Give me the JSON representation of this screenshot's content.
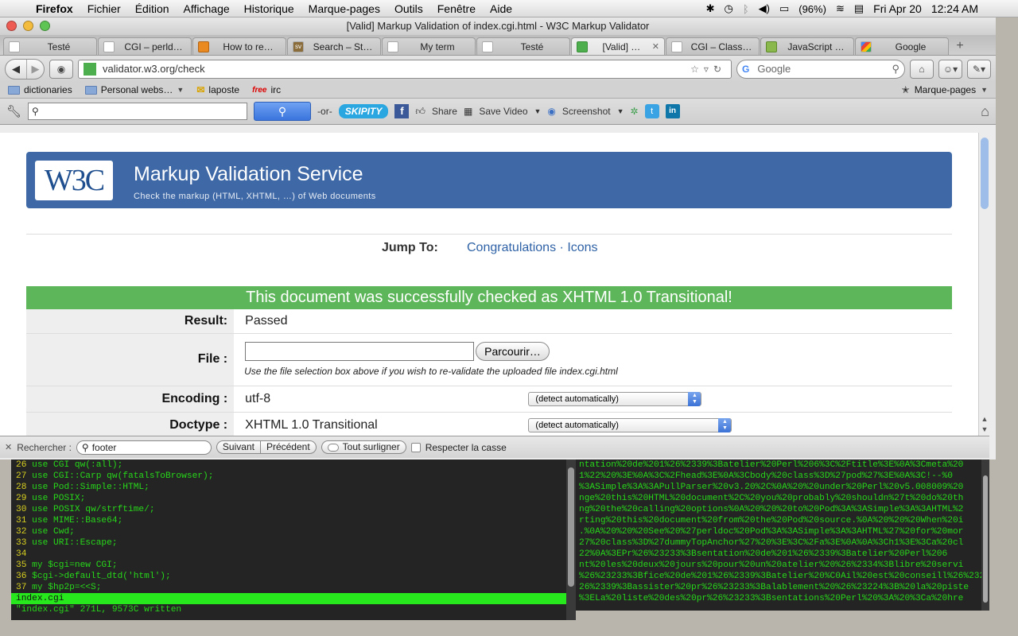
{
  "menubar": {
    "app": "Firefox",
    "items": [
      "Fichier",
      "Édition",
      "Affichage",
      "Historique",
      "Marque-pages",
      "Outils",
      "Fenêtre",
      "Aide"
    ],
    "battery": "(96%)",
    "date": "Fri Apr 20",
    "time": "12:24 AM"
  },
  "window": {
    "title": "[Valid] Markup Validation of index.cgi.html - W3C Markup Validator"
  },
  "tabs": [
    {
      "label": "Testé",
      "icon": "blank"
    },
    {
      "label": "CGI – perld…",
      "icon": "blank"
    },
    {
      "label": "How to re…",
      "icon": "orange"
    },
    {
      "label": "Search – St…",
      "icon": "sv"
    },
    {
      "label": "My term",
      "icon": "blank"
    },
    {
      "label": "Testé",
      "icon": "blank"
    },
    {
      "label": "[Valid] …",
      "icon": "green",
      "active": true
    },
    {
      "label": "CGI – Class…",
      "icon": "blank"
    },
    {
      "label": "JavaScript …",
      "icon": "js"
    },
    {
      "label": "Google",
      "icon": "google"
    }
  ],
  "navbar": {
    "url": "validator.w3.org/check",
    "search_engine": "G",
    "search_placeholder": "Google"
  },
  "bookmarks": {
    "items": [
      "dictionaries",
      "Personal webs…",
      "laposte",
      "irc"
    ],
    "right": "Marque-pages"
  },
  "toolbar2": {
    "or_text": "-or-",
    "skipity": "SKIPITY",
    "share": "Share",
    "save_video": "Save Video",
    "screenshot": "Screenshot"
  },
  "validator": {
    "title": "Markup Validation Service",
    "subtitle": "Check the markup (HTML, XHTML, …) of Web documents",
    "jump_label": "Jump To:",
    "jump_link_1": "Congratulations",
    "jump_sep": "·",
    "jump_link_2": "Icons",
    "result_header": "This document was successfully checked as XHTML 1.0 Transitional!",
    "rows": {
      "result_label": "Result:",
      "result_value": "Passed",
      "file_label": "File :",
      "file_button": "Parcourir…",
      "file_hint": "Use the file selection box above if you wish to re-validate the uploaded file index.cgi.html",
      "encoding_label": "Encoding :",
      "encoding_value": "utf-8",
      "encoding_select": "(detect automatically)",
      "doctype_label": "Doctype :",
      "doctype_value": "XHTML 1.0 Transitional",
      "doctype_select": "(detect automatically)"
    }
  },
  "findbar": {
    "label": "Rechercher :",
    "value": "footer",
    "next": "Suivant",
    "prev": "Précédent",
    "highlight": "Tout surligner",
    "match_case": "Respecter la casse"
  },
  "terminal_left": {
    "lines": [
      {
        "no": "26",
        "text": "use CGI qw(:all);"
      },
      {
        "no": "27",
        "text": "use CGI::Carp qw(fatalsToBrowser);"
      },
      {
        "no": "28",
        "text": "use Pod::Simple::HTML;"
      },
      {
        "no": "29",
        "text": "use POSIX;"
      },
      {
        "no": "30",
        "text": "use POSIX qw/strftime/;"
      },
      {
        "no": "31",
        "text": "use MIME::Base64;"
      },
      {
        "no": "32",
        "text": "use Cwd;"
      },
      {
        "no": "33",
        "text": "use URI::Escape;"
      },
      {
        "no": "34",
        "text": ""
      },
      {
        "no": "35",
        "text": "my $cgi=new CGI;"
      },
      {
        "no": "36",
        "text": "$cgi->default_dtd('html');"
      },
      {
        "no": "37",
        "text": "my $hp2p=<<S;"
      }
    ],
    "status_bar": "index.cgi",
    "message": "\"index.cgi\" 271L, 9573C written"
  },
  "terminal_right": {
    "lines": [
      "ntation%20de%201%26%2339%3Batelier%20Perl%206%3C%2Ftitle%3E%0A%3Cmeta%20",
      "1%22%20%3E%0A%3C%2Fhead%3E%0A%3Cbody%20class%3D%27pod%27%3E%0A%3C!--%0",
      "%3ASimple%3A%3APullParser%20v3.20%2C%0A%20%20under%20Perl%20v5.008009%20",
      "nge%20this%20HTML%20document%2C%20you%20probably%20shouldn%27t%20do%20th",
      "ng%20the%20calling%20options%0A%20%20%20to%20Pod%3A%3ASimple%3A%3AHTML%2",
      "rting%20this%20document%20from%20the%20Pod%20source.%0A%20%20%20When%20i",
      ".%0A%20%20%20See%20%27perldoc%20Pod%3A%3ASimple%3A%3AHTML%27%20for%20mor",
      "27%20class%3D%27dummyTopAnchor%27%20%3E%3C%2Fa%3E%0A%0A%3Ch1%3E%3Ca%20cl",
      "22%0A%3EPr%26%23233%3Bsentation%20de%201%26%2339%3Batelier%20Perl%206",
      "nt%20les%20deux%20jours%20pour%20un%20atelier%20%26%2334%3Blibre%20servi",
      "%26%23233%3Bfice%20de%201%26%2339%3Batelier%20%C0Ail%20est%20conseill%26%23233%",
      "26%2339%3Bassister%20pr%26%23233%3Balablement%20%26%23224%3B%20la%20piste",
      "%3ELa%20liste%20des%20pr%26%23233%3Bsentations%20Perl%20%3A%20%3Ca%20hre"
    ]
  }
}
